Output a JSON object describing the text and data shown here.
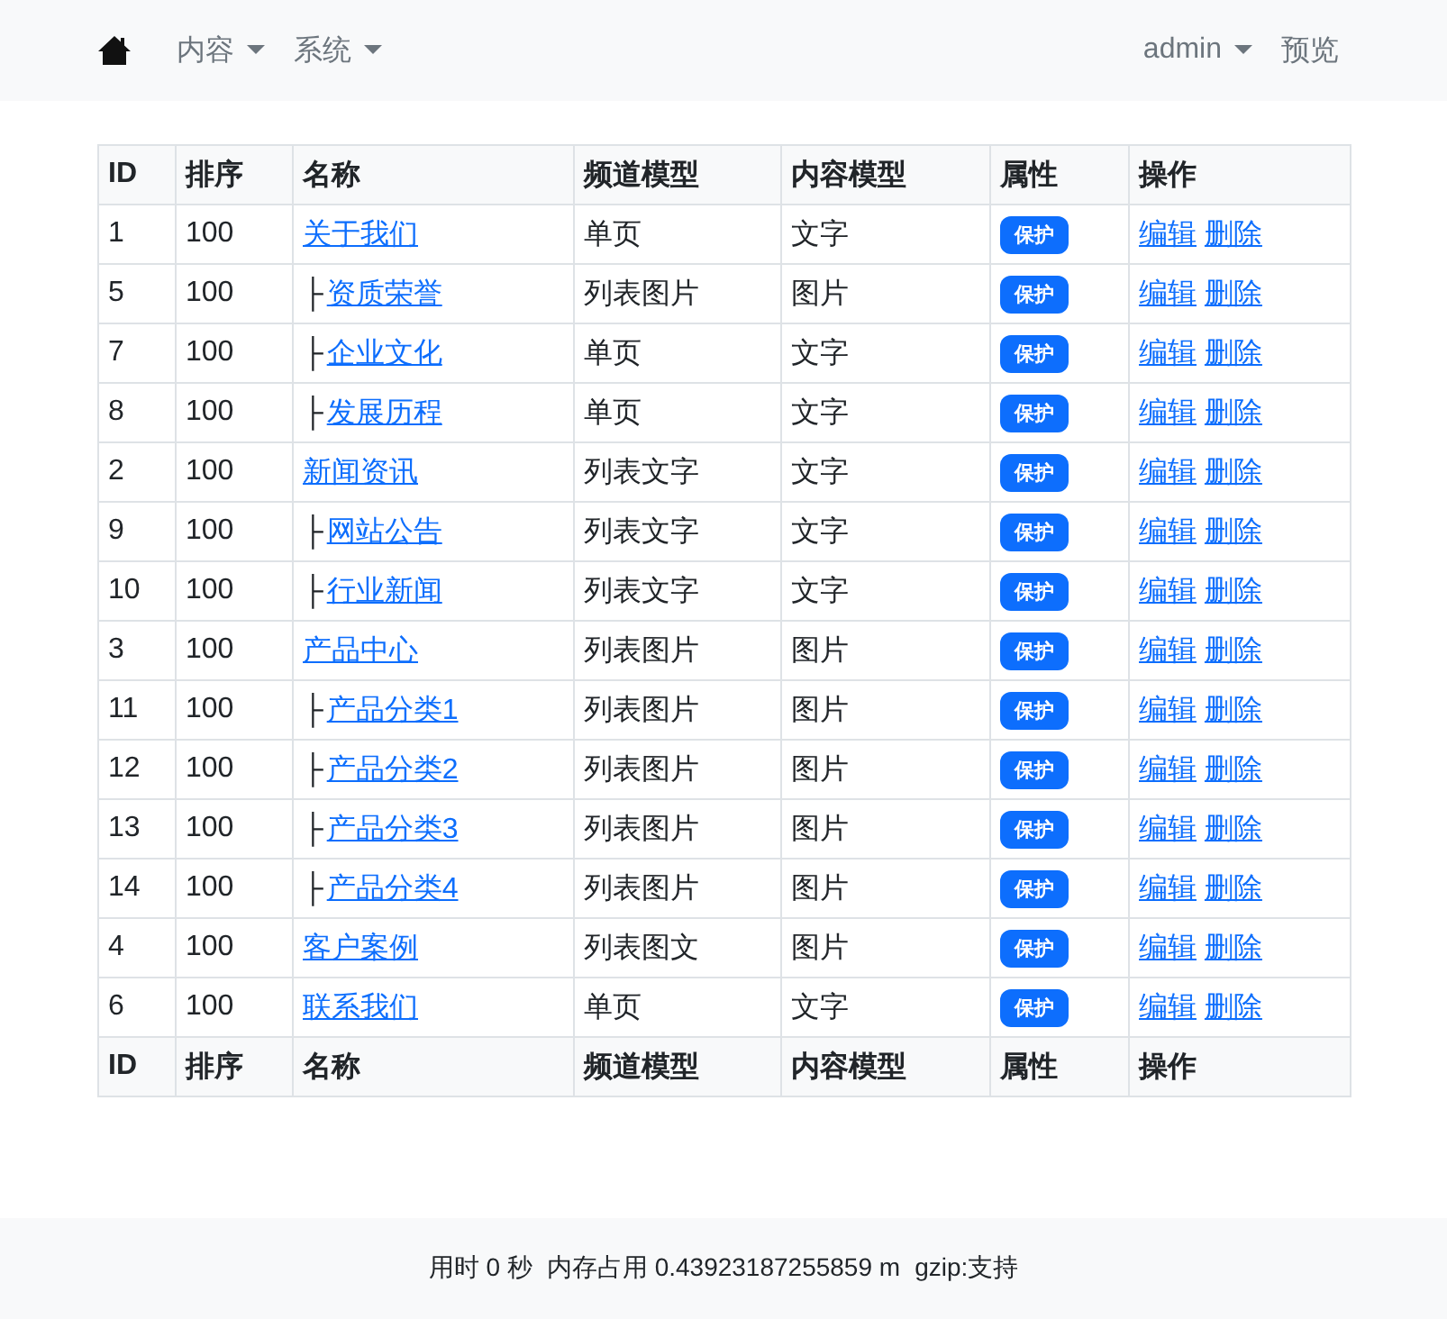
{
  "navbar": {
    "menus": [
      {
        "label": "内容",
        "dropdown": true
      },
      {
        "label": "系统",
        "dropdown": true
      }
    ],
    "right": [
      {
        "label": "admin",
        "dropdown": true
      },
      {
        "label": "预览",
        "dropdown": false
      }
    ]
  },
  "table": {
    "columns": [
      "ID",
      "排序",
      "名称",
      "频道模型",
      "内容模型",
      "属性",
      "操作"
    ],
    "rows": [
      {
        "id": "1",
        "sort": "100",
        "name": "关于我们",
        "channel_model": "单页",
        "content_model": "文字",
        "attribute": "保护",
        "actions": [
          "编辑",
          "删除"
        ]
      },
      {
        "id": "5",
        "sort": "100",
        "prefix": "├",
        "name": "资质荣誉",
        "channel_model": "列表图片",
        "content_model": "图片",
        "attribute": "保护",
        "actions": [
          "编辑",
          "删除"
        ]
      },
      {
        "id": "7",
        "sort": "100",
        "prefix": "├",
        "name": "企业文化",
        "channel_model": "单页",
        "content_model": "文字",
        "attribute": "保护",
        "actions": [
          "编辑",
          "删除"
        ]
      },
      {
        "id": "8",
        "sort": "100",
        "prefix": "├",
        "name": "发展历程",
        "channel_model": "单页",
        "content_model": "文字",
        "attribute": "保护",
        "actions": [
          "编辑",
          "删除"
        ]
      },
      {
        "id": "2",
        "sort": "100",
        "name": "新闻资讯",
        "channel_model": "列表文字",
        "content_model": "文字",
        "attribute": "保护",
        "actions": [
          "编辑",
          "删除"
        ]
      },
      {
        "id": "9",
        "sort": "100",
        "prefix": "├",
        "name": "网站公告",
        "channel_model": "列表文字",
        "content_model": "文字",
        "attribute": "保护",
        "actions": [
          "编辑",
          "删除"
        ]
      },
      {
        "id": "10",
        "sort": "100",
        "prefix": "├",
        "name": "行业新闻",
        "channel_model": "列表文字",
        "content_model": "文字",
        "attribute": "保护",
        "actions": [
          "编辑",
          "删除"
        ]
      },
      {
        "id": "3",
        "sort": "100",
        "name": "产品中心",
        "channel_model": "列表图片",
        "content_model": "图片",
        "attribute": "保护",
        "actions": [
          "编辑",
          "删除"
        ]
      },
      {
        "id": "11",
        "sort": "100",
        "prefix": "├",
        "name": "产品分类1",
        "channel_model": "列表图片",
        "content_model": "图片",
        "attribute": "保护",
        "actions": [
          "编辑",
          "删除"
        ]
      },
      {
        "id": "12",
        "sort": "100",
        "prefix": "├",
        "name": "产品分类2",
        "channel_model": "列表图片",
        "content_model": "图片",
        "attribute": "保护",
        "actions": [
          "编辑",
          "删除"
        ]
      },
      {
        "id": "13",
        "sort": "100",
        "prefix": "├",
        "name": "产品分类3",
        "channel_model": "列表图片",
        "content_model": "图片",
        "attribute": "保护",
        "actions": [
          "编辑",
          "删除"
        ]
      },
      {
        "id": "14",
        "sort": "100",
        "prefix": "├",
        "name": "产品分类4",
        "channel_model": "列表图片",
        "content_model": "图片",
        "attribute": "保护",
        "actions": [
          "编辑",
          "删除"
        ]
      },
      {
        "id": "4",
        "sort": "100",
        "name": "客户案例",
        "channel_model": "列表图文",
        "content_model": "图片",
        "attribute": "保护",
        "actions": [
          "编辑",
          "删除"
        ]
      },
      {
        "id": "6",
        "sort": "100",
        "name": "联系我们",
        "channel_model": "单页",
        "content_model": "文字",
        "attribute": "保护",
        "actions": [
          "编辑",
          "删除"
        ]
      }
    ],
    "footer_columns": [
      "ID",
      "排序",
      "名称",
      "频道模型",
      "内容模型",
      "属性",
      "操作"
    ]
  },
  "status_bar": [
    "用时 0 秒",
    "内存占用 0.43923187255859 m",
    "gzip:支持"
  ]
}
